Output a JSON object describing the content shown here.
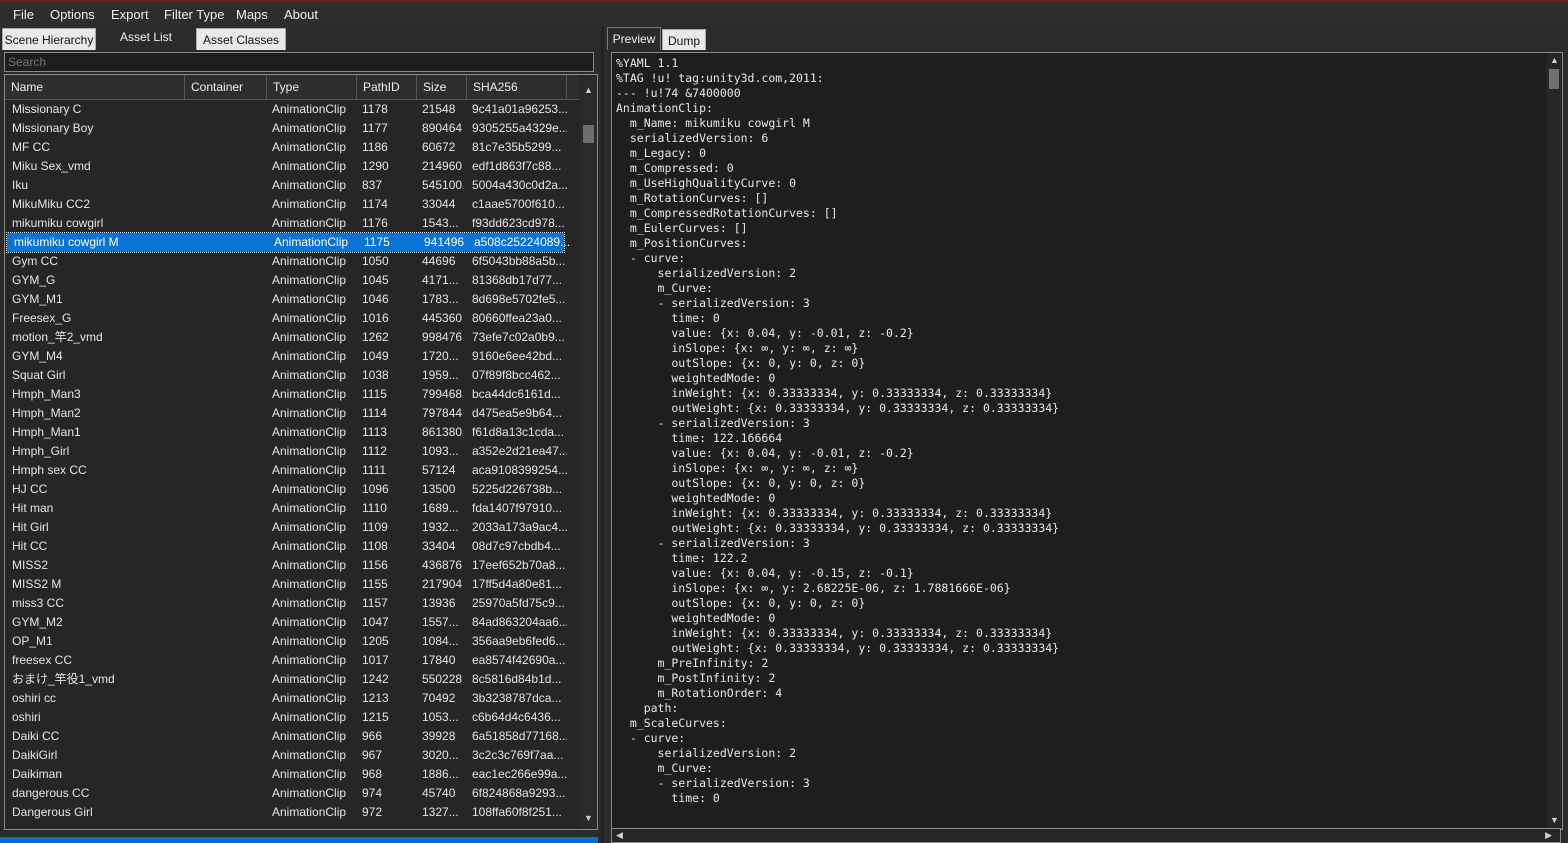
{
  "menu": [
    "File",
    "Options",
    "Export",
    "Filter Type",
    "Maps",
    "About"
  ],
  "left_tabs": [
    "Scene Hierarchy",
    "Asset List",
    "Asset Classes"
  ],
  "search": {
    "placeholder": "Search"
  },
  "columns": [
    "Name",
    "Container",
    "Type",
    "PathID",
    "Size",
    "SHA256"
  ],
  "rows": [
    [
      "Missionary C",
      "",
      "AnimationClip",
      "1178",
      "21548",
      "9c41a01a96253..."
    ],
    [
      "Missionary Boy",
      "",
      "AnimationClip",
      "1177",
      "890464",
      "9305255a4329e..."
    ],
    [
      "MF CC",
      "",
      "AnimationClip",
      "1186",
      "60672",
      "81c7e35b5299..."
    ],
    [
      "Miku Sex_vmd",
      "",
      "AnimationClip",
      "1290",
      "214960",
      "edf1d863f7c88..."
    ],
    [
      "Iku",
      "",
      "AnimationClip",
      "837",
      "545100",
      "5004a430c0d2a..."
    ],
    [
      "MikuMiku CC2",
      "",
      "AnimationClip",
      "1174",
      "33044",
      "c1aae5700f610..."
    ],
    [
      "mikumiku cowgirl",
      "",
      "AnimationClip",
      "1176",
      "1543...",
      "f93dd623cd978..."
    ],
    [
      "mikumiku cowgirl M",
      "",
      "AnimationClip",
      "1175",
      "941496",
      "a508c25224089..."
    ],
    [
      "Gym CC",
      "",
      "AnimationClip",
      "1050",
      "44696",
      "6f5043bb88a5b..."
    ],
    [
      "GYM_G",
      "",
      "AnimationClip",
      "1045",
      "4171...",
      "81368db17d77..."
    ],
    [
      "GYM_M1",
      "",
      "AnimationClip",
      "1046",
      "1783...",
      "8d698e5702fe5..."
    ],
    [
      "Freesex_G",
      "",
      "AnimationClip",
      "1016",
      "445360",
      "80660ffea23a0..."
    ],
    [
      "motion_竿2_vmd",
      "",
      "AnimationClip",
      "1262",
      "998476",
      "73efe7c02a0b9..."
    ],
    [
      "GYM_M4",
      "",
      "AnimationClip",
      "1049",
      "1720...",
      "9160e6ee42bd..."
    ],
    [
      "Squat Girl",
      "",
      "AnimationClip",
      "1038",
      "1959...",
      "07f89f8bcc462..."
    ],
    [
      "Hmph_Man3",
      "",
      "AnimationClip",
      "1115",
      "799468",
      "bca44dc6161d..."
    ],
    [
      "Hmph_Man2",
      "",
      "AnimationClip",
      "1114",
      "797844",
      "d475ea5e9b64..."
    ],
    [
      "Hmph_Man1",
      "",
      "AnimationClip",
      "1113",
      "861380",
      "f61d8a13c1cda..."
    ],
    [
      "Hmph_Girl",
      "",
      "AnimationClip",
      "1112",
      "1093...",
      "a352e2d21ea47..."
    ],
    [
      "Hmph sex CC",
      "",
      "AnimationClip",
      "1111",
      "57124",
      "aca9108399254..."
    ],
    [
      "HJ CC",
      "",
      "AnimationClip",
      "1096",
      "13500",
      "5225d226738b..."
    ],
    [
      "Hit man",
      "",
      "AnimationClip",
      "1110",
      "1689...",
      "fda1407f97910..."
    ],
    [
      "Hit Girl",
      "",
      "AnimationClip",
      "1109",
      "1932...",
      "2033a173a9ac4..."
    ],
    [
      "Hit CC",
      "",
      "AnimationClip",
      "1108",
      "33404",
      "08d7c97cbdb4..."
    ],
    [
      "MISS2",
      "",
      "AnimationClip",
      "1156",
      "436876",
      "17eef652b70a8..."
    ],
    [
      "MISS2 M",
      "",
      "AnimationClip",
      "1155",
      "217904",
      "17ff5d4a80e81..."
    ],
    [
      "miss3 CC",
      "",
      "AnimationClip",
      "1157",
      "13936",
      "25970a5fd75c9..."
    ],
    [
      "GYM_M2",
      "",
      "AnimationClip",
      "1047",
      "1557...",
      "84ad863204aa6..."
    ],
    [
      "OP_M1",
      "",
      "AnimationClip",
      "1205",
      "1084...",
      "356aa9eb6fed6..."
    ],
    [
      "freesex CC",
      "",
      "AnimationClip",
      "1017",
      "17840",
      "ea8574f42690a..."
    ],
    [
      "おまけ_竿役1_vmd",
      "",
      "AnimationClip",
      "1242",
      "550228",
      "8c5816d84b1d..."
    ],
    [
      "oshiri cc",
      "",
      "AnimationClip",
      "1213",
      "70492",
      "3b3238787dca..."
    ],
    [
      "oshiri",
      "",
      "AnimationClip",
      "1215",
      "1053...",
      "c6b64d4c6436..."
    ],
    [
      "Daiki CC",
      "",
      "AnimationClip",
      "966",
      "39928",
      "6a51858d77168..."
    ],
    [
      "DaikiGirl",
      "",
      "AnimationClip",
      "967",
      "3020...",
      "3c2c3c769f7aa..."
    ],
    [
      "Daikiman",
      "",
      "AnimationClip",
      "968",
      "1886...",
      "eac1ec266e99a..."
    ],
    [
      "dangerous CC",
      "",
      "AnimationClip",
      "974",
      "45740",
      "6f824868a9293..."
    ],
    [
      "Dangerous Girl",
      "",
      "AnimationClip",
      "972",
      "1327...",
      "108ffa60f8f251..."
    ]
  ],
  "selected_row": 7,
  "right_tabs": [
    "Preview",
    "Dump"
  ],
  "preview_lines": [
    "%YAML 1.1",
    "%TAG !u! tag:unity3d.com,2011:",
    "--- !u!74 &7400000",
    "AnimationClip:",
    "  m_Name: mikumiku cowgirl M",
    "  serializedVersion: 6",
    "  m_Legacy: 0",
    "  m_Compressed: 0",
    "  m_UseHighQualityCurve: 0",
    "  m_RotationCurves: []",
    "  m_CompressedRotationCurves: []",
    "  m_EulerCurves: []",
    "  m_PositionCurves:",
    "  - curve:",
    "      serializedVersion: 2",
    "      m_Curve:",
    "      - serializedVersion: 3",
    "        time: 0",
    "        value: {x: 0.04, y: -0.01, z: -0.2}",
    "        inSlope: {x: ∞, y: ∞, z: ∞}",
    "        outSlope: {x: 0, y: 0, z: 0}",
    "        weightedMode: 0",
    "        inWeight: {x: 0.33333334, y: 0.33333334, z: 0.33333334}",
    "        outWeight: {x: 0.33333334, y: 0.33333334, z: 0.33333334}",
    "      - serializedVersion: 3",
    "        time: 122.166664",
    "        value: {x: 0.04, y: -0.01, z: -0.2}",
    "        inSlope: {x: ∞, y: ∞, z: ∞}",
    "        outSlope: {x: 0, y: 0, z: 0}",
    "        weightedMode: 0",
    "        inWeight: {x: 0.33333334, y: 0.33333334, z: 0.33333334}",
    "        outWeight: {x: 0.33333334, y: 0.33333334, z: 0.33333334}",
    "      - serializedVersion: 3",
    "        time: 122.2",
    "        value: {x: 0.04, y: -0.15, z: -0.1}",
    "        inSlope: {x: ∞, y: 2.68225E-06, z: 1.7881666E-06}",
    "        outSlope: {x: 0, y: 0, z: 0}",
    "        weightedMode: 0",
    "        inWeight: {x: 0.33333334, y: 0.33333334, z: 0.33333334}",
    "        outWeight: {x: 0.33333334, y: 0.33333334, z: 0.33333334}",
    "      m_PreInfinity: 2",
    "      m_PostInfinity: 2",
    "      m_RotationOrder: 4",
    "    path:",
    "  m_ScaleCurves:",
    "  - curve:",
    "      serializedVersion: 2",
    "      m_Curve:",
    "      - serializedVersion: 3",
    "        time: 0"
  ],
  "colors": {
    "selection": "#0a74d6",
    "status_bar": "#0a6fc7",
    "title_accent": "#7a1e24"
  }
}
